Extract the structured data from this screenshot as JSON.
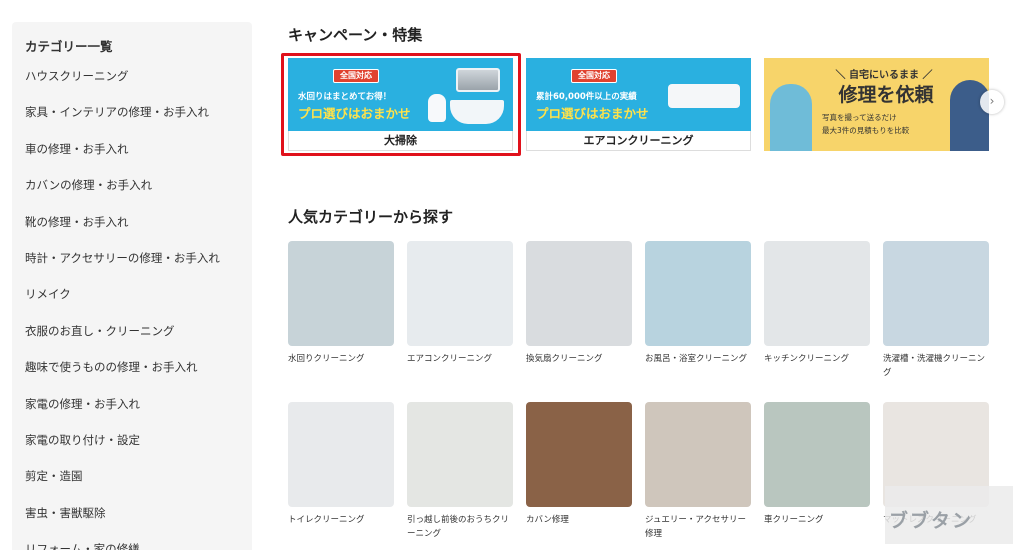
{
  "sidebar": {
    "title": "カテゴリー一覧",
    "items": [
      {
        "label": "ハウスクリーニング"
      },
      {
        "label": "家具・インテリアの修理・お手入れ"
      },
      {
        "label": "車の修理・お手入れ"
      },
      {
        "label": "カバンの修理・お手入れ"
      },
      {
        "label": "靴の修理・お手入れ"
      },
      {
        "label": "時計・アクセサリーの修理・お手入れ"
      },
      {
        "label": "リメイク"
      },
      {
        "label": "衣服のお直し・クリーニング"
      },
      {
        "label": "趣味で使うものの修理・お手入れ"
      },
      {
        "label": "家電の修理・お手入れ"
      },
      {
        "label": "家電の取り付け・設定"
      },
      {
        "label": "剪定・造園"
      },
      {
        "label": "害虫・害獣駆除"
      },
      {
        "label": "リフォーム・家の修繕"
      }
    ]
  },
  "campaign": {
    "title": "キャンペーン・特集",
    "banners": [
      {
        "badge": "全国対応",
        "line1": "水回りはまとめてお得！",
        "line2": "プロ選びはおまかせ",
        "caption": "大掃除",
        "color": "#2ab0e0"
      },
      {
        "badge": "全国対応",
        "line1": "累計60,000件以上の実績",
        "line2": "プロ選びはおまかせ",
        "caption": "エアコンクリーニング",
        "color": "#2ab0e0"
      },
      {
        "head": "＼ 自宅にいるまま ／",
        "main": "修理を依頼",
        "sub1": "写真を撮って送るだけ",
        "sub2": "最大3件の見積もりを比較",
        "color": "#f7d46a"
      }
    ],
    "highlight_color": "#e0111b",
    "next_icon": "chevron-right-icon"
  },
  "popular": {
    "title": "人気カテゴリーから探す",
    "row1": [
      {
        "label": "水回りクリーニング",
        "color": "#c7d3d8"
      },
      {
        "label": "エアコンクリーニング",
        "color": "#e7ebee"
      },
      {
        "label": "換気扇クリーニング",
        "color": "#d9dcdf"
      },
      {
        "label": "お風呂・浴室クリーニング",
        "color": "#b8d3df"
      },
      {
        "label": "キッチンクリーニング",
        "color": "#e3e6e8"
      },
      {
        "label": "洗濯槽・洗濯機クリーニング",
        "color": "#c8d7e1"
      }
    ],
    "row2": [
      {
        "label": "トイレクリーニング",
        "color": "#e8eaec"
      },
      {
        "label": "引っ越し前後のおうちクリーニング",
        "color": "#e4e6e3"
      },
      {
        "label": "カバン修理",
        "color": "#8a6247"
      },
      {
        "label": "ジュエリー・アクセサリー修理",
        "color": "#cfc6bc"
      },
      {
        "label": "車クリーニング",
        "color": "#b9c6bf"
      },
      {
        "label": "マットレスクリーニング",
        "color": "#e9e5e1"
      }
    ]
  },
  "watermark": "ブブタン"
}
